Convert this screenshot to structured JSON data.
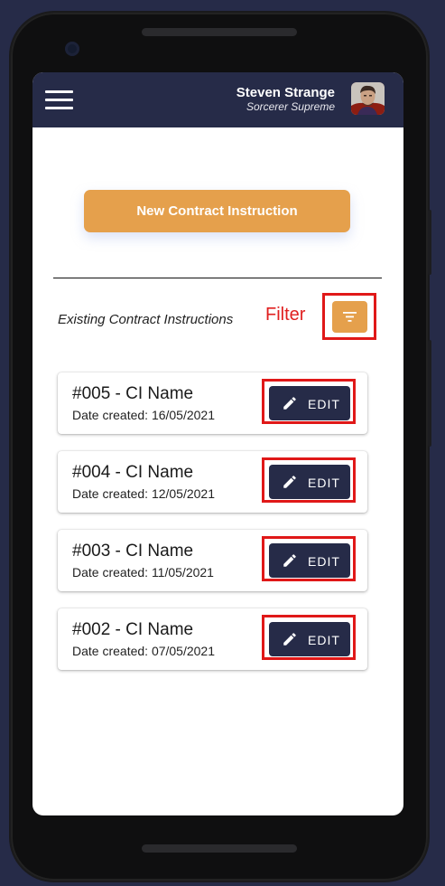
{
  "header": {
    "user_name": "Steven Strange",
    "user_role": "Sorcerer Supreme",
    "menu_icon": "hamburger-menu-icon",
    "avatar": "user-avatar"
  },
  "actions": {
    "new_button_label": "New Contract Instruction"
  },
  "section": {
    "title": "Existing Contract Instructions",
    "filter_label": "Filter",
    "filter_icon": "filter-list-icon"
  },
  "instructions": [
    {
      "title": "#005 - CI Name",
      "date": "Date created: 16/05/2021",
      "action_label": "EDIT"
    },
    {
      "title": "#004 - CI Name",
      "date": "Date created: 12/05/2021",
      "action_label": "EDIT"
    },
    {
      "title": "#003 - CI Name",
      "date": "Date created: 11/05/2021",
      "action_label": "EDIT"
    },
    {
      "title": "#002 - CI Name",
      "date": "Date created: 07/05/2021",
      "action_label": "EDIT"
    }
  ],
  "colors": {
    "background": "#262b48",
    "appbar": "#262b48",
    "accent": "#e5a04c",
    "highlight": "#e01818",
    "edit_button": "#262b48"
  }
}
